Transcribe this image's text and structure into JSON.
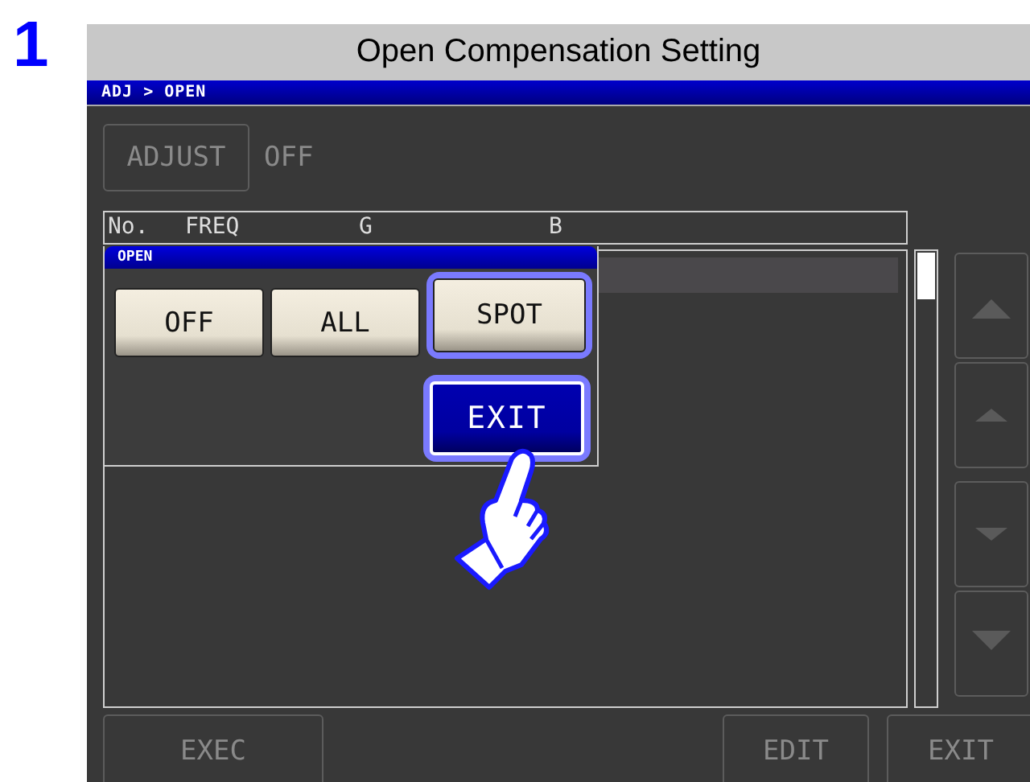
{
  "step": "1",
  "title": "Open Compensation Setting",
  "breadcrumb": "ADJ > OPEN",
  "adjust": {
    "label": "ADJUST",
    "value": "OFF",
    "disabled": true
  },
  "table": {
    "columns": [
      "No.",
      "FREQ",
      "G",
      "B"
    ]
  },
  "scroll_buttons": [
    {
      "kind": "page-up",
      "disabled": true
    },
    {
      "kind": "up",
      "disabled": true
    },
    {
      "kind": "down",
      "disabled": true
    },
    {
      "kind": "page-down",
      "disabled": true
    }
  ],
  "footer_buttons": [
    {
      "label": "EXEC",
      "disabled": true
    },
    {
      "label": "EDIT",
      "disabled": true
    },
    {
      "label": "EXIT",
      "disabled": true
    }
  ],
  "dialog": {
    "title": "OPEN",
    "options": [
      {
        "label": "OFF",
        "selected": false
      },
      {
        "label": "ALL",
        "selected": false
      },
      {
        "label": "SPOT",
        "selected": true
      }
    ],
    "exit_button": "EXIT"
  }
}
